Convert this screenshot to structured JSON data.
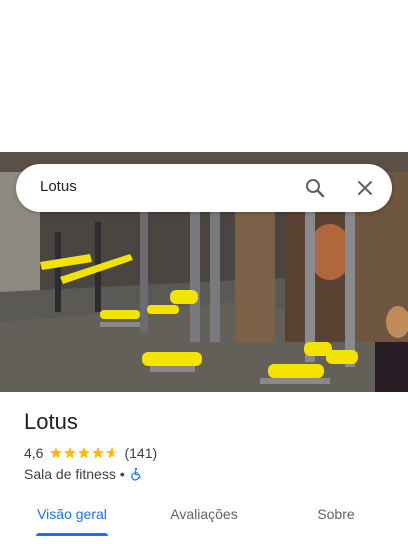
{
  "search": {
    "query": "Lotus"
  },
  "place": {
    "name": "Lotus",
    "rating": "4,6",
    "rating_value": 4.6,
    "stars_max": 5,
    "review_count": "(141)",
    "category": "Sala de fitness",
    "separator": "•"
  },
  "tabs": [
    {
      "label": "Visão geral",
      "active": true
    },
    {
      "label": "Avaliações",
      "active": false
    },
    {
      "label": "Sobre",
      "active": false
    }
  ],
  "colors": {
    "accent": "#1a73e8",
    "star": "#fbbc04",
    "equipment_yellow": "#f2e400"
  },
  "icons": {
    "search": "search-icon",
    "close": "close-icon",
    "wheelchair": "wheelchair-accessible-icon",
    "star": "star-icon"
  }
}
